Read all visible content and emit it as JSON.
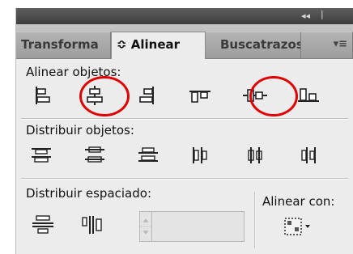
{
  "titlebar": {
    "controls": "◂◂ | ✕"
  },
  "tabs": [
    {
      "label": "Transforma",
      "state": "inactive"
    },
    {
      "label": "≎ Alinear",
      "state": "active"
    },
    {
      "label": "Buscatrazos",
      "state": "inactive"
    }
  ],
  "panel_menu": "▾≡",
  "align_objects": {
    "label": "Alinear objetos:",
    "buttons": [
      "align-left-edges",
      "align-horizontal-centers",
      "align-right-edges",
      "align-top-edges",
      "align-vertical-centers",
      "align-bottom-edges"
    ],
    "highlighted": [
      "align-horizontal-centers",
      "align-vertical-centers"
    ]
  },
  "distribute_objects": {
    "label": "Distribuir objetos:",
    "buttons": [
      "distribute-top",
      "distribute-vertical-centers",
      "distribute-bottom",
      "distribute-left",
      "distribute-horizontal-centers",
      "distribute-right"
    ]
  },
  "distribute_spacing": {
    "label": "Distribuir espaciado:",
    "buttons": [
      "vertical-distribute-space",
      "horizontal-distribute-space"
    ],
    "value": ""
  },
  "align_to": {
    "label": "Alinear con:",
    "dropdown_arrow": "▾"
  },
  "colors": {
    "highlight_circle": "#e00000"
  }
}
